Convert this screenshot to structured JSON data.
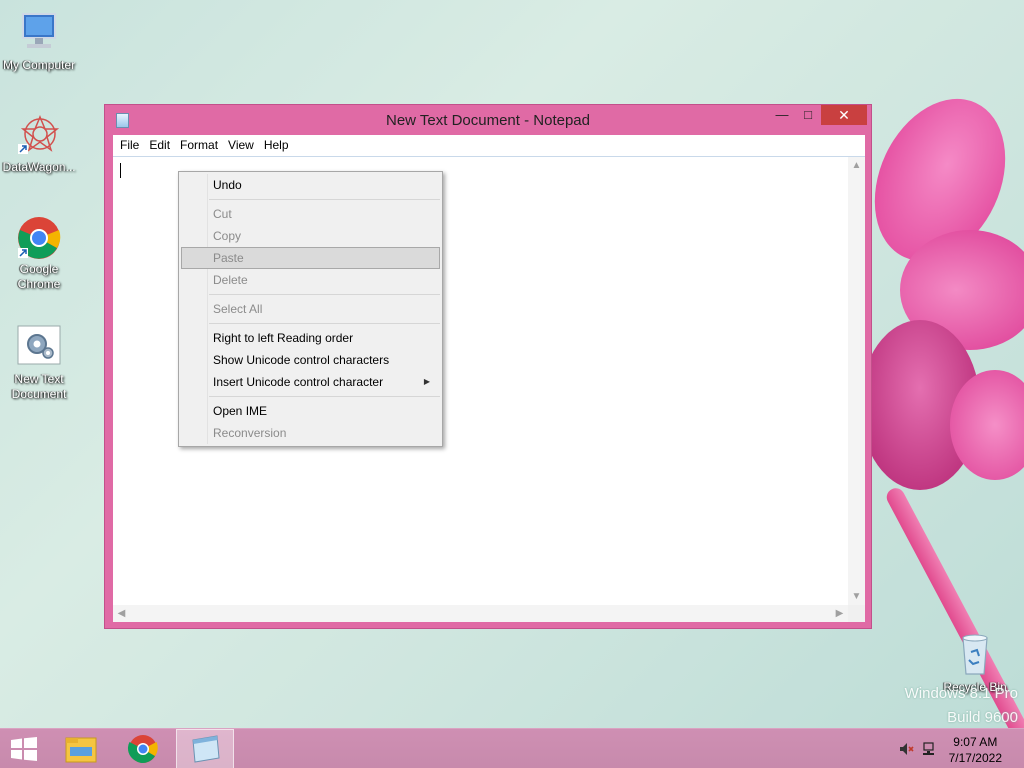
{
  "desktop": {
    "icons": [
      {
        "label_lines": [
          "My Computer"
        ]
      },
      {
        "label_lines": [
          "DataWagon..."
        ]
      },
      {
        "label_lines": [
          "Google",
          "Chrome"
        ]
      },
      {
        "label_lines": [
          "New Text",
          "Document"
        ]
      },
      {
        "label_lines": [
          "Recycle Bin"
        ]
      }
    ],
    "watermark": {
      "line1": "Windows 8.1 Pro",
      "line2": "Build 9600"
    }
  },
  "window": {
    "title": "New Text Document - Notepad",
    "controls": {
      "minimize": "—",
      "maximize": "□",
      "close": "✕"
    },
    "menu": [
      "File",
      "Edit",
      "Format",
      "View",
      "Help"
    ],
    "content": ""
  },
  "context_menu": {
    "items": [
      {
        "label": "Undo",
        "enabled": true
      },
      {
        "label": "Cut",
        "enabled": false
      },
      {
        "label": "Copy",
        "enabled": false
      },
      {
        "label": "Paste",
        "enabled": false,
        "highlighted": true
      },
      {
        "label": "Delete",
        "enabled": false
      },
      {
        "label": "Select All",
        "enabled": false
      },
      {
        "label": "Right to left Reading order",
        "enabled": true
      },
      {
        "label": "Show Unicode control characters",
        "enabled": true
      },
      {
        "label": "Insert Unicode control character",
        "enabled": true,
        "submenu": true
      },
      {
        "label": "Open IME",
        "enabled": true
      },
      {
        "label": "Reconversion",
        "enabled": false
      }
    ]
  },
  "taskbar": {
    "apps": [
      "file-explorer-icon",
      "chrome-icon",
      "notepad-icon"
    ],
    "active_app": "notepad-icon",
    "tray": {
      "volume": "muted",
      "network": "wired"
    },
    "clock": {
      "time": "9:07 AM",
      "date": "7/17/2022"
    }
  },
  "colors": {
    "window_frame": "#e06aa5",
    "taskbar": "#cf8fb3",
    "close_button": "#c94040",
    "wallpaper": "#cfe6df"
  }
}
